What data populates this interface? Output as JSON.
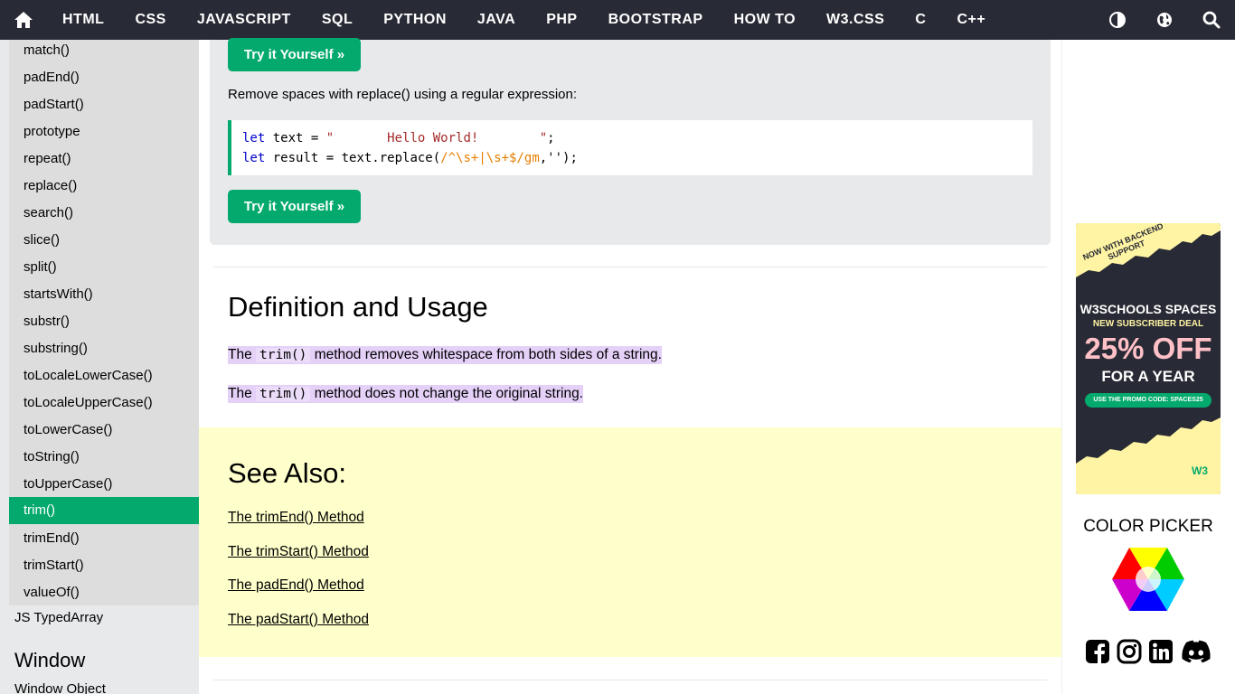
{
  "nav": {
    "items": [
      "HTML",
      "CSS",
      "JAVASCRIPT",
      "SQL",
      "PYTHON",
      "JAVA",
      "PHP",
      "BOOTSTRAP",
      "HOW TO",
      "W3.CSS",
      "C",
      "C++"
    ],
    "icons": [
      "home-icon",
      "contrast-icon",
      "globe-icon",
      "search-icon"
    ]
  },
  "sidebar": {
    "items": [
      "match()",
      "padEnd()",
      "padStart()",
      "prototype",
      "repeat()",
      "replace()",
      "search()",
      "slice()",
      "split()",
      "startsWith()",
      "substr()",
      "substring()",
      "toLocaleLowerCase()",
      "toLocaleUpperCase()",
      "toLowerCase()",
      "toString()",
      "toUpperCase()",
      "trim()",
      "trimEnd()",
      "trimStart()",
      "valueOf()"
    ],
    "active": "trim()",
    "typed_array": "JS TypedArray",
    "section_heading": "Window",
    "window_object": "Window Object"
  },
  "example": {
    "try_button": "Try it Yourself »",
    "description": "Remove spaces with replace() using a regular expression:",
    "code": {
      "line1_kw": "let",
      "line1_a": " text = ",
      "line1_str": "\"       Hello World!        \"",
      "line1_b": ";",
      "line2_kw": "let",
      "line2_a": " result = text.replace(",
      "line2_re": "/^\\s+|\\s+$/gm",
      "line2_b": ",'');"
    }
  },
  "definition": {
    "heading": "Definition and Usage",
    "p1_pre": "The ",
    "p1_code": "trim()",
    "p1_post": " method removes whitespace from both sides of a string.",
    "p2_pre": "The ",
    "p2_code": "trim()",
    "p2_post": " method does not change the original string."
  },
  "see_also": {
    "heading": "See Also:",
    "links": [
      "The trimEnd() Method",
      "The trimStart() Method",
      "The padEnd() Method",
      "The padStart() Method"
    ]
  },
  "ad": {
    "badge": "NOW WITH BACKEND SUPPORT",
    "title": "W3SCHOOLS SPACES",
    "subtitle": "NEW SUBSCRIBER DEAL",
    "discount": "25% OFF",
    "period": "FOR A YEAR",
    "promo": "USE THE PROMO CODE: SPACES25",
    "logo": "W3"
  },
  "color_picker": {
    "title": "COLOR PICKER"
  },
  "social": [
    "facebook-icon",
    "instagram-icon",
    "linkedin-icon",
    "discord-icon"
  ],
  "colors": {
    "nav_bg": "#282A35",
    "accent": "#04AA6D",
    "sidebar_bg": "#E7E9EB",
    "see_also_bg": "#FFFFCC",
    "highlight": "#E5D0F8"
  }
}
